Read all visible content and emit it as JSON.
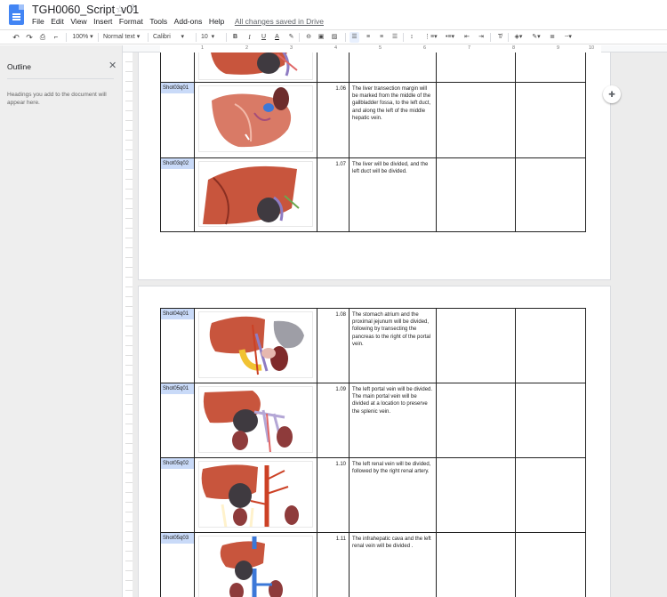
{
  "app": {
    "doc_title": "TGH0060_Script_v01",
    "save_status": "All changes saved in Drive",
    "menu": [
      "File",
      "Edit",
      "View",
      "Insert",
      "Format",
      "Tools",
      "Add-ons",
      "Help"
    ]
  },
  "toolbar": {
    "zoom": "100%",
    "style": "Normal text",
    "font": "Calibri",
    "size": "10",
    "bold": "B",
    "italic": "I",
    "underline": "U",
    "text_color": "A"
  },
  "ruler": {
    "ticks": [
      "1",
      "2",
      "3",
      "4",
      "5",
      "6",
      "7",
      "8",
      "9",
      "10"
    ]
  },
  "outline": {
    "title": "Outline",
    "hint": "Headings you add to the document will appear here."
  },
  "colors": {
    "accent": "#4285f4",
    "shot_label_bg": "#c9daf8",
    "tissue": "#c8553d"
  },
  "rows": [
    {
      "shot": "Shot03q01",
      "num": "1.06",
      "desc": "The liver transection margin will be marked from the middle of the gallbladder fossa, to the left duct, and along the left of the middle hepatic vein."
    },
    {
      "shot": "Shot03q02",
      "num": "1.07",
      "desc": "The liver will be divided, and the left duct will be divided."
    },
    {
      "shot": "Shot04q01",
      "num": "1.08",
      "desc": "The stomach atrium and the proximal jejunum will be divided, following by transecting the pancreas to the right of the portal vein."
    },
    {
      "shot": "Shot05q01",
      "num": "1.09",
      "desc": "The left portal vein will be divided. The main portal vein will be divided at a location to preserve the splenic vein."
    },
    {
      "shot": "Shot05q02",
      "num": "1.10",
      "desc": "The left renal vein will be divided, followed by the right renal artery."
    },
    {
      "shot": "Shot05q03",
      "num": "1.11",
      "desc": "The infrahepatic cava and the left renal vein will be divided ."
    }
  ]
}
